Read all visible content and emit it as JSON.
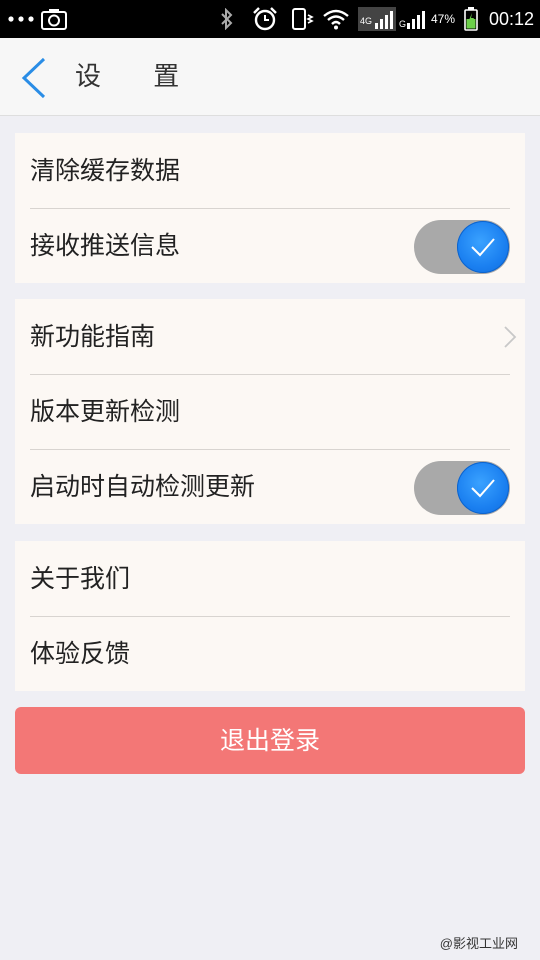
{
  "status_bar": {
    "signal_4g": "4G",
    "signal_g": "G",
    "battery_percent": "47%",
    "time": "00:12",
    "icons": [
      "more-dots-icon",
      "camera-icon",
      "bluetooth-icon",
      "alarm-icon",
      "vibrate-icon",
      "wifi-icon",
      "signal-icon",
      "battery-icon"
    ]
  },
  "header": {
    "title": "设 置"
  },
  "groups": [
    {
      "items": [
        {
          "label": "清除缓存数据"
        },
        {
          "label": "接收推送信息",
          "toggle": true
        }
      ]
    },
    {
      "items": [
        {
          "label": "新功能指南",
          "chevron": true
        },
        {
          "label": "版本更新检测"
        },
        {
          "label": "启动时自动检测更新",
          "toggle": true
        }
      ]
    },
    {
      "items": [
        {
          "label": "关于我们"
        },
        {
          "label": "体验反馈"
        }
      ]
    }
  ],
  "logout_label": "退出登录",
  "watermark": "@影视工业网",
  "colors": {
    "accent": "#1a7ff0",
    "logout": "#f37776",
    "background": "#efeff4",
    "group_bg": "#fcf8f4",
    "toggle_track": "#a9a9a9"
  }
}
